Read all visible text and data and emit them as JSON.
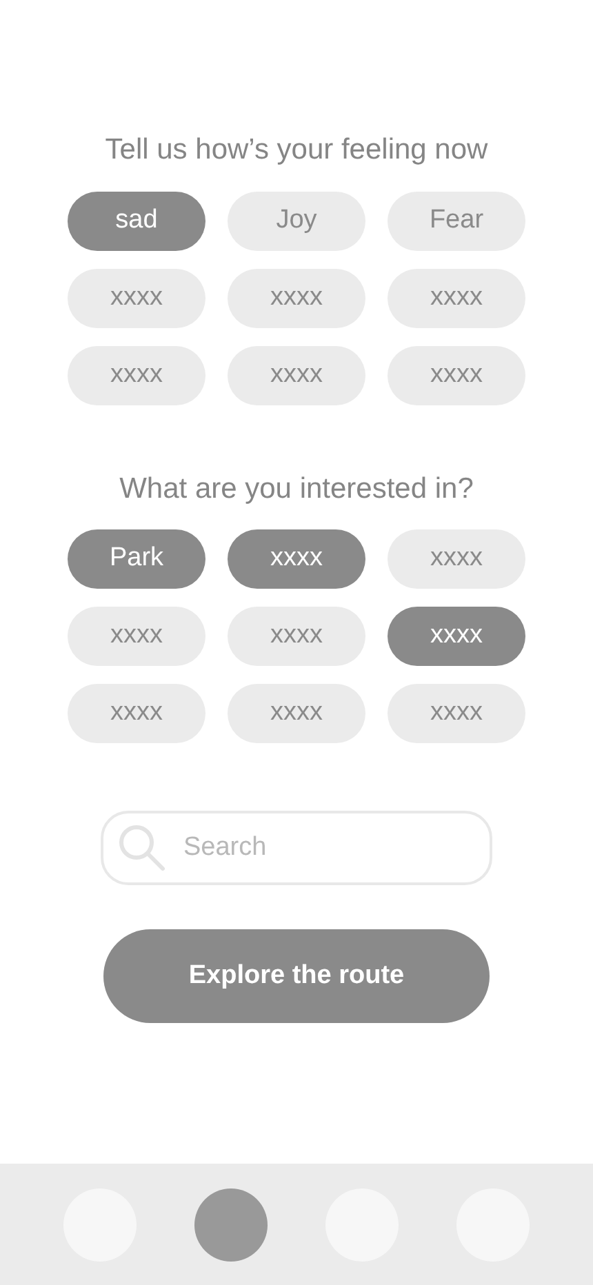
{
  "feelings": {
    "title": "Tell us how’s your feeling now",
    "options": [
      {
        "label": "sad",
        "selected": true
      },
      {
        "label": "Joy",
        "selected": false
      },
      {
        "label": "Fear",
        "selected": false
      },
      {
        "label": "xxxx",
        "selected": false
      },
      {
        "label": "xxxx",
        "selected": false
      },
      {
        "label": "xxxx",
        "selected": false
      },
      {
        "label": "xxxx",
        "selected": false
      },
      {
        "label": "xxxx",
        "selected": false
      },
      {
        "label": "xxxx",
        "selected": false
      }
    ]
  },
  "interests": {
    "title": "What are you interested in?",
    "options": [
      {
        "label": "Park",
        "selected": true
      },
      {
        "label": "xxxx",
        "selected": true
      },
      {
        "label": "xxxx",
        "selected": false
      },
      {
        "label": "xxxx",
        "selected": false
      },
      {
        "label": "xxxx",
        "selected": false
      },
      {
        "label": "xxxx",
        "selected": true
      },
      {
        "label": "xxxx",
        "selected": false
      },
      {
        "label": "xxxx",
        "selected": false
      },
      {
        "label": "xxxx",
        "selected": false
      }
    ]
  },
  "search": {
    "placeholder": "Search"
  },
  "button": "Explore the route",
  "nav": [
    {
      "selected": false
    },
    {
      "selected": true
    },
    {
      "selected": false
    },
    {
      "selected": false
    }
  ]
}
